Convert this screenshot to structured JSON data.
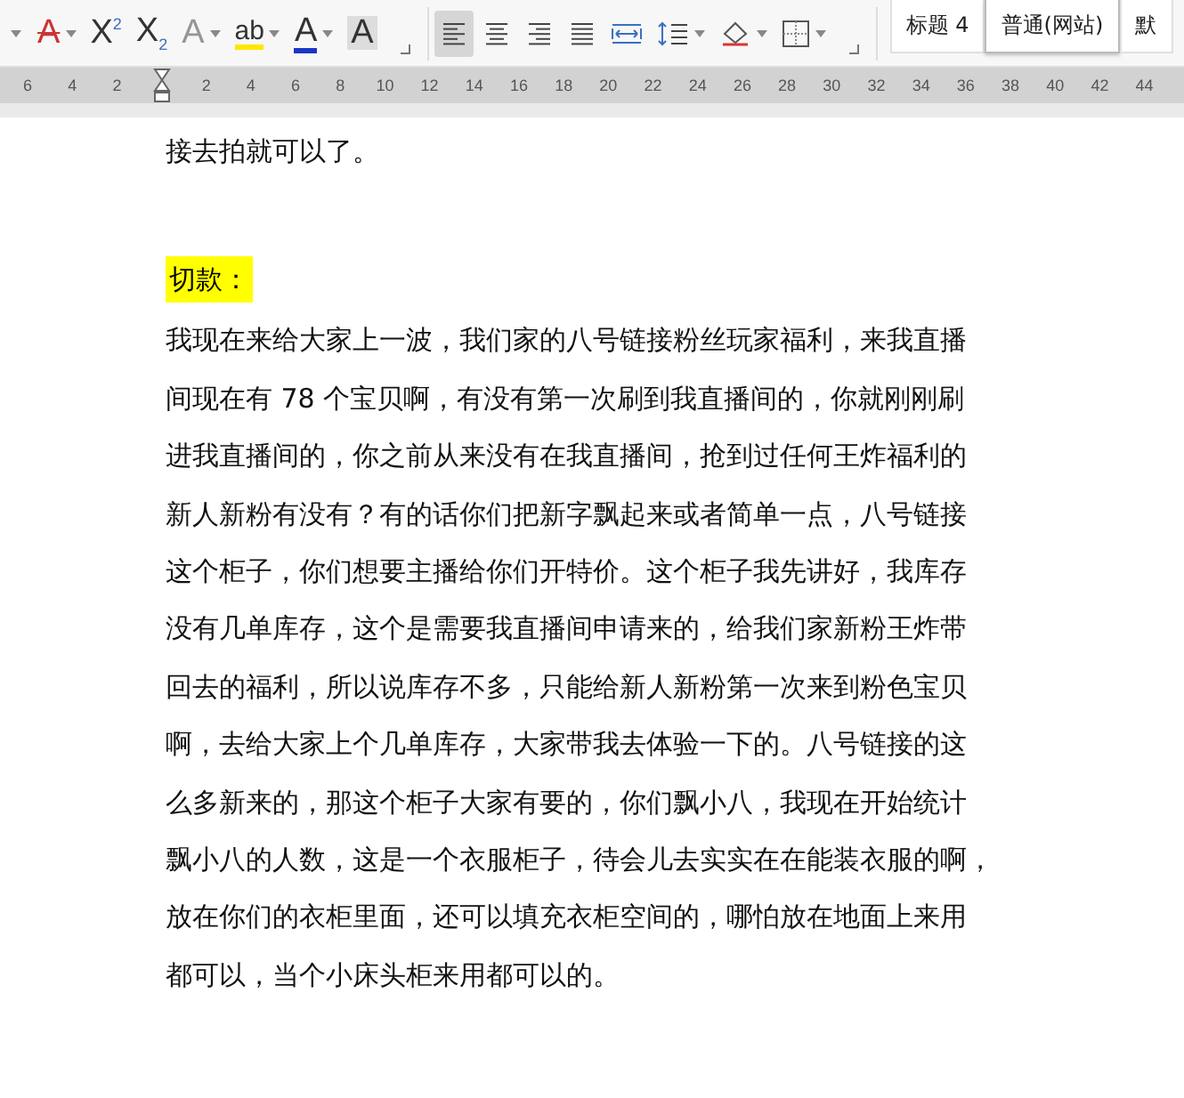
{
  "toolbar": {
    "font_tools": [
      {
        "kind": "dropdown-only"
      },
      {
        "kind": "strike",
        "glyph": "A",
        "dropdown": true
      },
      {
        "kind": "superscript",
        "glyph": "X",
        "index": "2",
        "dropdown": false
      },
      {
        "kind": "subscript",
        "glyph": "X",
        "index": "2",
        "dropdown": false
      },
      {
        "kind": "effect",
        "glyph": "A",
        "dropdown": true,
        "disabled": true
      },
      {
        "kind": "highlight",
        "glyph": "ab",
        "dropdown": true
      },
      {
        "kind": "fontcolor",
        "glyph": "A",
        "dropdown": true
      },
      {
        "kind": "shading",
        "glyph": "A",
        "dropdown": false
      }
    ],
    "paragraph_tools": [
      {
        "kind": "align-left",
        "selected": true,
        "dropdown": false
      },
      {
        "kind": "align-center",
        "selected": false,
        "dropdown": false
      },
      {
        "kind": "align-right",
        "selected": false,
        "dropdown": false
      },
      {
        "kind": "justify",
        "selected": false,
        "dropdown": false
      },
      {
        "kind": "distribute",
        "selected": false,
        "dropdown": false
      },
      {
        "kind": "line-spacing",
        "selected": false,
        "dropdown": true
      },
      {
        "kind": "fill",
        "selected": false,
        "dropdown": true
      },
      {
        "kind": "borders",
        "selected": false,
        "dropdown": true
      }
    ],
    "styles": [
      {
        "label": "标题 4",
        "selected": false
      },
      {
        "label": "普通(网站)",
        "selected": true
      },
      {
        "label": "默",
        "selected": false
      }
    ]
  },
  "ruler": {
    "left_numbers": [
      "6",
      "4",
      "2"
    ],
    "right_numbers": [
      "2",
      "4",
      "6",
      "8",
      "10",
      "12",
      "14",
      "16",
      "18",
      "20",
      "22",
      "24",
      "26",
      "28",
      "30",
      "32",
      "34",
      "36",
      "38",
      "40",
      "42",
      "44"
    ]
  },
  "document": {
    "first_line": "接去拍就可以了。",
    "heading": "切款：",
    "heading_highlighted": true,
    "paragraph_lines": [
      "我现在来给大家上一波，我们家的八号链接粉丝玩家福利，来我直播",
      "间现在有 78 个宝贝啊，有没有第一次刷到我直播间的，你就刚刚刷",
      "进我直播间的，你之前从来没有在我直播间，抢到过任何王炸福利的",
      "新人新粉有没有？有的话你们把新字飘起来或者简单一点，八号链接",
      "这个柜子，你们想要主播给你们开特价。这个柜子我先讲好，我库存",
      "没有几单库存，这个是需要我直播间申请来的，给我们家新粉王炸带",
      "回去的福利，所以说库存不多，只能给新人新粉第一次来到粉色宝贝",
      "啊，去给大家上个几单库存，大家带我去体验一下的。八号链接的这",
      "么多新来的，那这个柜子大家有要的，你们飘小八，我现在开始统计",
      "飘小八的人数，这是一个衣服柜子，待会儿去实实在在能装衣服的啊，",
      "放在你们的衣柜里面，还可以填充衣柜空间的，哪怕放在地面上来用",
      "都可以，当个小床头柜来用都可以的。"
    ]
  }
}
